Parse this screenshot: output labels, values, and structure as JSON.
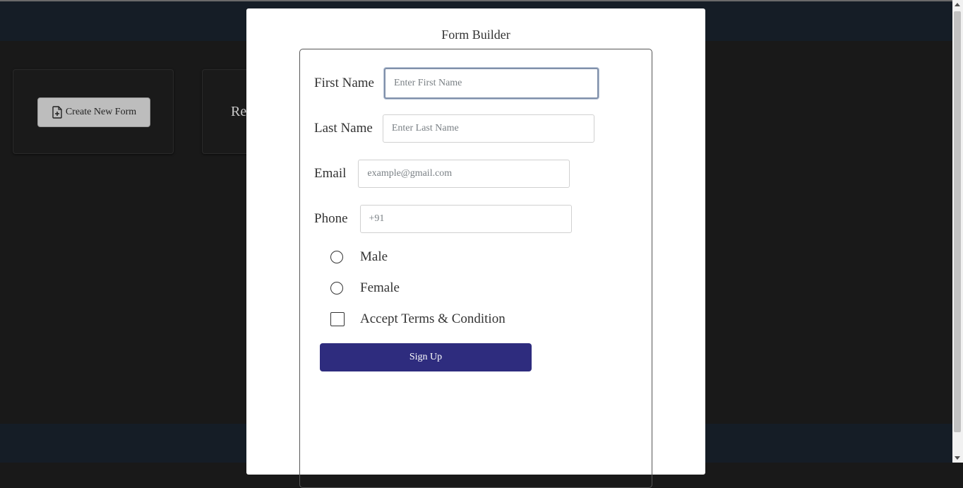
{
  "background": {
    "create_button_label": "Create New Form",
    "card2_text": "Re"
  },
  "modal": {
    "title": "Form Builder",
    "fields": [
      {
        "label": "First Name",
        "placeholder": "Enter First Name",
        "value": ""
      },
      {
        "label": "Last Name",
        "placeholder": "Enter Last Name",
        "value": ""
      },
      {
        "label": "Email",
        "placeholder": "example@gmail.com",
        "value": ""
      },
      {
        "label": "Phone",
        "placeholder": "+91",
        "value": ""
      }
    ],
    "options": {
      "male_label": "Male",
      "female_label": "Female",
      "terms_label": "Accept Terms & Condition"
    },
    "submit_label": "Sign Up"
  },
  "colors": {
    "page_bg": "#191919",
    "bar_bg": "#151d26",
    "signup_bg": "#2e2c7e",
    "create_btn_bg": "#bdbdbd"
  }
}
